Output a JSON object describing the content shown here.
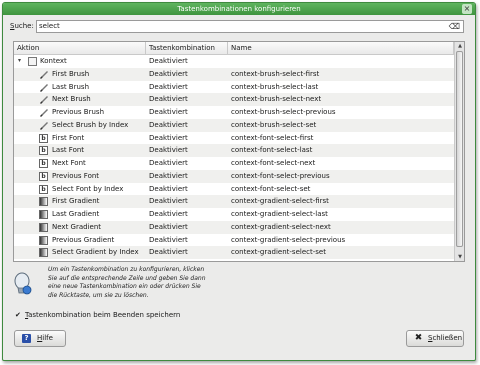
{
  "window": {
    "title": "Tastenkombinationen konfigurieren",
    "close_glyph": "×"
  },
  "search": {
    "label_mnemonic": "S",
    "label_rest": "uche:",
    "value": "select",
    "clear_glyph": "⌫"
  },
  "table": {
    "headers": [
      "Aktion",
      "Tastenkombination",
      "Name"
    ],
    "group": {
      "label": "Kontext",
      "shortcut": "Deaktiviert",
      "name": "",
      "expander": "▾"
    },
    "rows": [
      {
        "icon": "brush",
        "action": "First Brush",
        "shortcut": "Deaktiviert",
        "name": "context-brush-select-first"
      },
      {
        "icon": "brush",
        "action": "Last Brush",
        "shortcut": "Deaktiviert",
        "name": "context-brush-select-last"
      },
      {
        "icon": "brush",
        "action": "Next Brush",
        "shortcut": "Deaktiviert",
        "name": "context-brush-select-next"
      },
      {
        "icon": "brush",
        "action": "Previous Brush",
        "shortcut": "Deaktiviert",
        "name": "context-brush-select-previous"
      },
      {
        "icon": "brush",
        "action": "Select Brush by Index",
        "shortcut": "Deaktiviert",
        "name": "context-brush-select-set"
      },
      {
        "icon": "font",
        "action": "First Font",
        "shortcut": "Deaktiviert",
        "name": "context-font-select-first"
      },
      {
        "icon": "font",
        "action": "Last Font",
        "shortcut": "Deaktiviert",
        "name": "context-font-select-last"
      },
      {
        "icon": "font",
        "action": "Next Font",
        "shortcut": "Deaktiviert",
        "name": "context-font-select-next"
      },
      {
        "icon": "font",
        "action": "Previous Font",
        "shortcut": "Deaktiviert",
        "name": "context-font-select-previous"
      },
      {
        "icon": "font",
        "action": "Select Font by Index",
        "shortcut": "Deaktiviert",
        "name": "context-font-select-set"
      },
      {
        "icon": "gradient",
        "action": "First Gradient",
        "shortcut": "Deaktiviert",
        "name": "context-gradient-select-first"
      },
      {
        "icon": "gradient",
        "action": "Last Gradient",
        "shortcut": "Deaktiviert",
        "name": "context-gradient-select-last"
      },
      {
        "icon": "gradient",
        "action": "Next Gradient",
        "shortcut": "Deaktiviert",
        "name": "context-gradient-select-next"
      },
      {
        "icon": "gradient",
        "action": "Previous Gradient",
        "shortcut": "Deaktiviert",
        "name": "context-gradient-select-previous"
      },
      {
        "icon": "gradient",
        "action": "Select Gradient by Index",
        "shortcut": "Deaktiviert",
        "name": "context-gradient-select-set"
      }
    ]
  },
  "help": {
    "line1": "Um ein Tastenkombination zu konfigurieren, klicken",
    "line2": "Sie auf die entsprechende Zeile und geben Sie dann",
    "line3": "eine neue Tastenkombination ein oder drücken Sie",
    "line4": "die Rücktaste, um sie zu löschen."
  },
  "save_option": {
    "checked_glyph": "✔",
    "label_mnemonic": "T",
    "label_rest": "astenkombination beim Beenden speichern",
    "checked": true
  },
  "buttons": {
    "help_icon": "?",
    "help_mnemonic": "H",
    "help_rest": "ilfe",
    "close_icon": "✖",
    "close_mnemonic": "S",
    "close_rest": "chließen"
  },
  "colors": {
    "titlebar": "#4fa44f",
    "window_bg": "#ebebea"
  }
}
